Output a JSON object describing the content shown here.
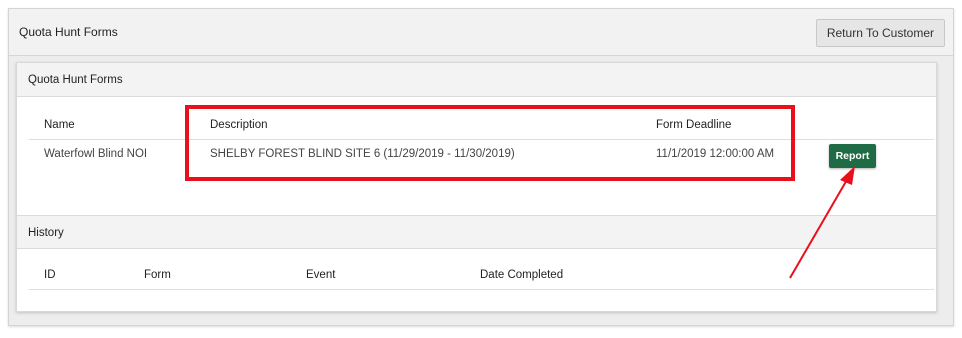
{
  "page": {
    "outer_title": "Quota Hunt Forms",
    "return_button_label": "Return To Customer"
  },
  "quota_hunt_forms": {
    "section_title": "Quota Hunt Forms",
    "columns": {
      "name": "Name",
      "description": "Description",
      "deadline": "Form Deadline"
    },
    "rows": [
      {
        "name": "Waterfowl Blind NOI",
        "description": "SHELBY FOREST BLIND SITE 6 (11/29/2019 - 11/30/2019)",
        "deadline": "11/1/2019 12:00:00 AM",
        "action_label": "Report"
      }
    ]
  },
  "history": {
    "section_title": "History",
    "columns": {
      "id": "ID",
      "form": "Form",
      "event": "Event",
      "date_completed": "Date Completed"
    }
  },
  "annotations": {
    "highlight_color": "#e8101a",
    "arrow_color": "#e8101a"
  },
  "colors": {
    "report_button": "#1e6b45"
  }
}
